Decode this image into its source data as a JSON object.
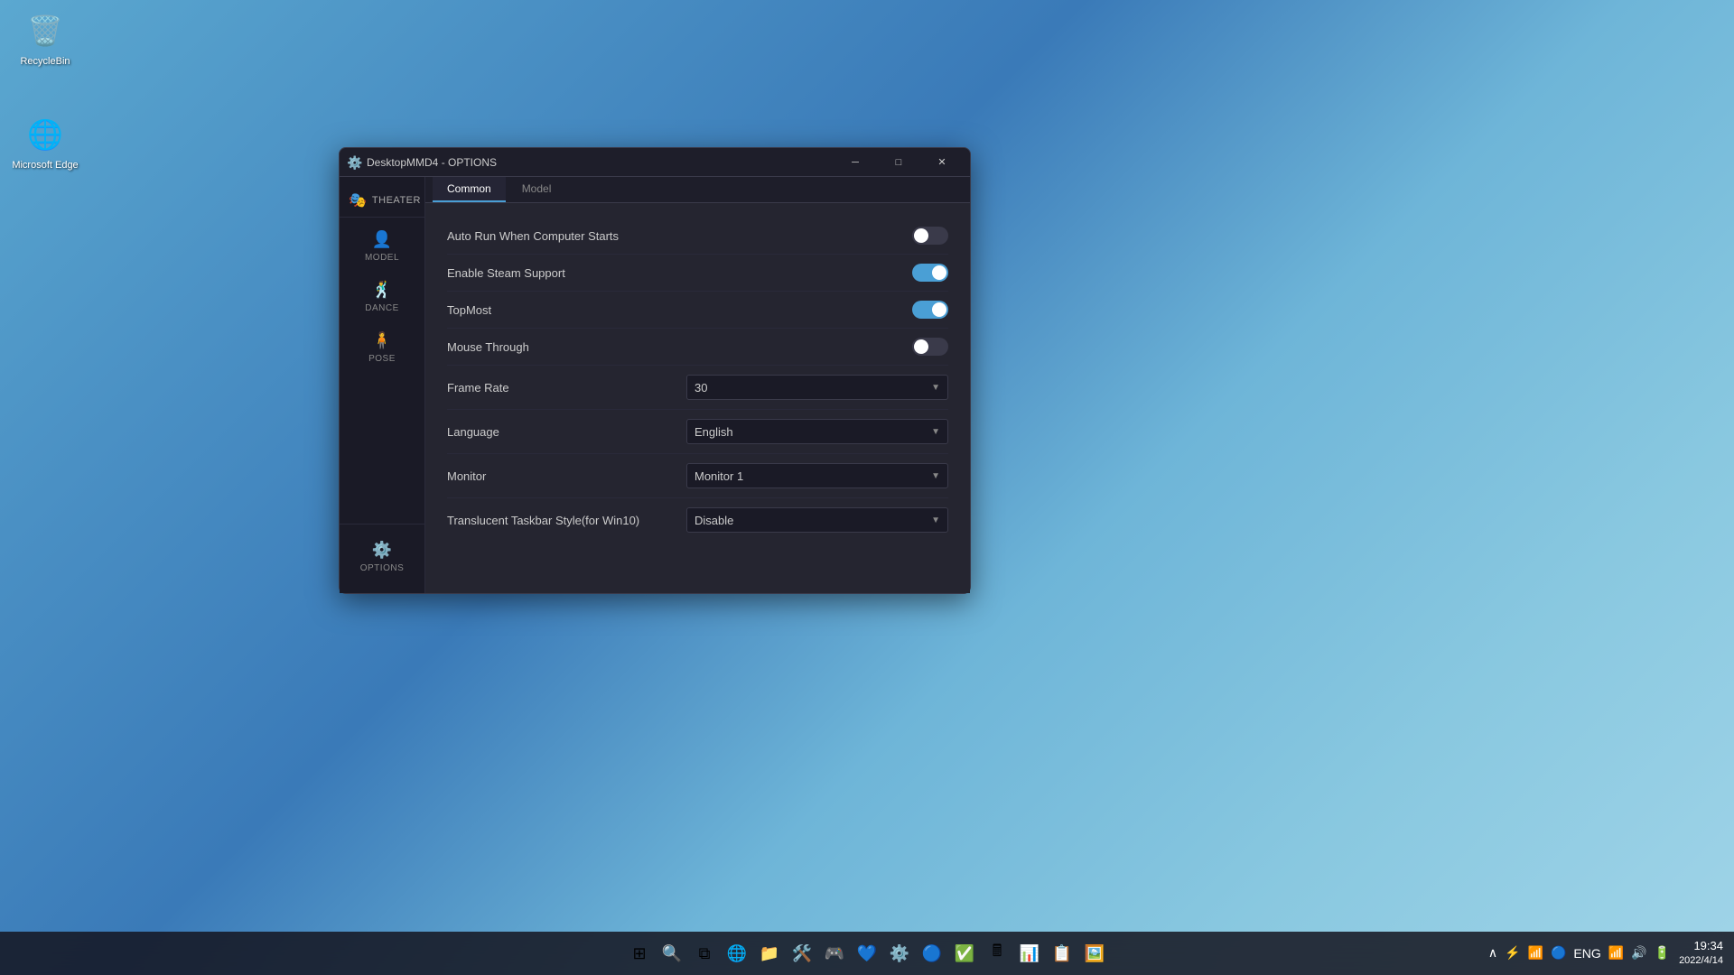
{
  "desktop": {
    "icons": [
      {
        "id": "recycle-bin",
        "label": "RecycleBin",
        "emoji": "🗑️"
      },
      {
        "id": "edge",
        "label": "Microsoft Edge",
        "emoji": "🌐"
      }
    ]
  },
  "taskbar": {
    "left_icons": [
      "⊞",
      "🔍"
    ],
    "center_icons": [
      {
        "name": "start",
        "emoji": "⊞"
      },
      {
        "name": "search",
        "emoji": "🔍"
      },
      {
        "name": "task-view",
        "emoji": "⧉"
      },
      {
        "name": "edge",
        "emoji": "🌐"
      },
      {
        "name": "file-explorer",
        "emoji": "📁"
      },
      {
        "name": "tools",
        "emoji": "🛠️"
      },
      {
        "name": "steam",
        "emoji": "🎮"
      },
      {
        "name": "vs",
        "emoji": "💙"
      },
      {
        "name": "settings",
        "emoji": "⚙️"
      },
      {
        "name": "edge2",
        "emoji": "🔵"
      },
      {
        "name": "check",
        "emoji": "✅"
      },
      {
        "name": "calc",
        "emoji": "🖩"
      },
      {
        "name": "unknown1",
        "emoji": "📊"
      },
      {
        "name": "unknown2",
        "emoji": "📋"
      },
      {
        "name": "ps",
        "emoji": "🖼️"
      }
    ],
    "time": "19:34",
    "date": "2022/4/14",
    "lang": "ENG"
  },
  "window": {
    "title": "DesktopMMD4 - OPTIONS",
    "icon": "⚙️",
    "sidebar": {
      "header_label": "THEATER",
      "header_icon": "🎭",
      "items": [
        {
          "id": "model",
          "label": "MODEL",
          "icon": "👤"
        },
        {
          "id": "dance",
          "label": "DANCE",
          "icon": "🕺"
        },
        {
          "id": "pose",
          "label": "POSE",
          "icon": "🧍"
        }
      ],
      "bottom_item": {
        "id": "options",
        "label": "OPTIONS",
        "icon": "⚙️"
      }
    },
    "tabs": [
      {
        "id": "common",
        "label": "Common",
        "active": true
      },
      {
        "id": "model",
        "label": "Model",
        "active": false
      }
    ],
    "settings": {
      "title": "Common",
      "rows": [
        {
          "id": "auto-run",
          "label": "Auto Run When Computer Starts",
          "type": "toggle",
          "state": "off"
        },
        {
          "id": "steam-support",
          "label": "Enable Steam Support",
          "type": "toggle",
          "state": "on"
        },
        {
          "id": "topmost",
          "label": "TopMost",
          "type": "toggle",
          "state": "on"
        },
        {
          "id": "mouse-through",
          "label": "Mouse Through",
          "type": "toggle",
          "state": "off"
        },
        {
          "id": "frame-rate",
          "label": "Frame Rate",
          "type": "dropdown",
          "value": "30"
        },
        {
          "id": "language",
          "label": "Language",
          "type": "dropdown",
          "value": "English"
        },
        {
          "id": "monitor",
          "label": "Monitor",
          "type": "dropdown",
          "value": "Monitor 1"
        },
        {
          "id": "taskbar-style",
          "label": "Translucent Taskbar Style(for Win10)",
          "type": "dropdown",
          "value": "Disable"
        }
      ]
    }
  }
}
